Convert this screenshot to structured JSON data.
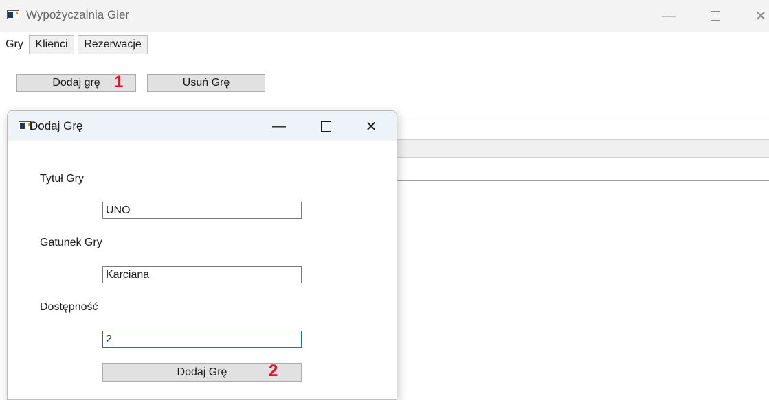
{
  "window": {
    "title": "Wypożyczalnia Gier",
    "minimize_glyph": "—",
    "close_glyph": "✕"
  },
  "tabs": [
    {
      "label": "Gry",
      "active": true
    },
    {
      "label": "Klienci",
      "active": false
    },
    {
      "label": "Rezerwacje",
      "active": false
    }
  ],
  "toolbar": {
    "add_label": "Dodaj grę",
    "add_badge": "1",
    "remove_label": "Usuń Grę"
  },
  "dialog": {
    "title": "Dodaj Grę",
    "minimize_glyph": "—",
    "close_glyph": "✕",
    "fields": [
      {
        "label": "Tytuł Gry",
        "value": "UNO"
      },
      {
        "label": "Gatunek Gry",
        "value": "Karciana"
      },
      {
        "label": "Dostępność",
        "value": "2"
      }
    ],
    "submit_label": "Dodaj Grę",
    "submit_badge": "2"
  },
  "colors": {
    "badge": "#e81123",
    "dialog_titlebar": "#eef3fa",
    "focus_border": "#0078d7"
  }
}
